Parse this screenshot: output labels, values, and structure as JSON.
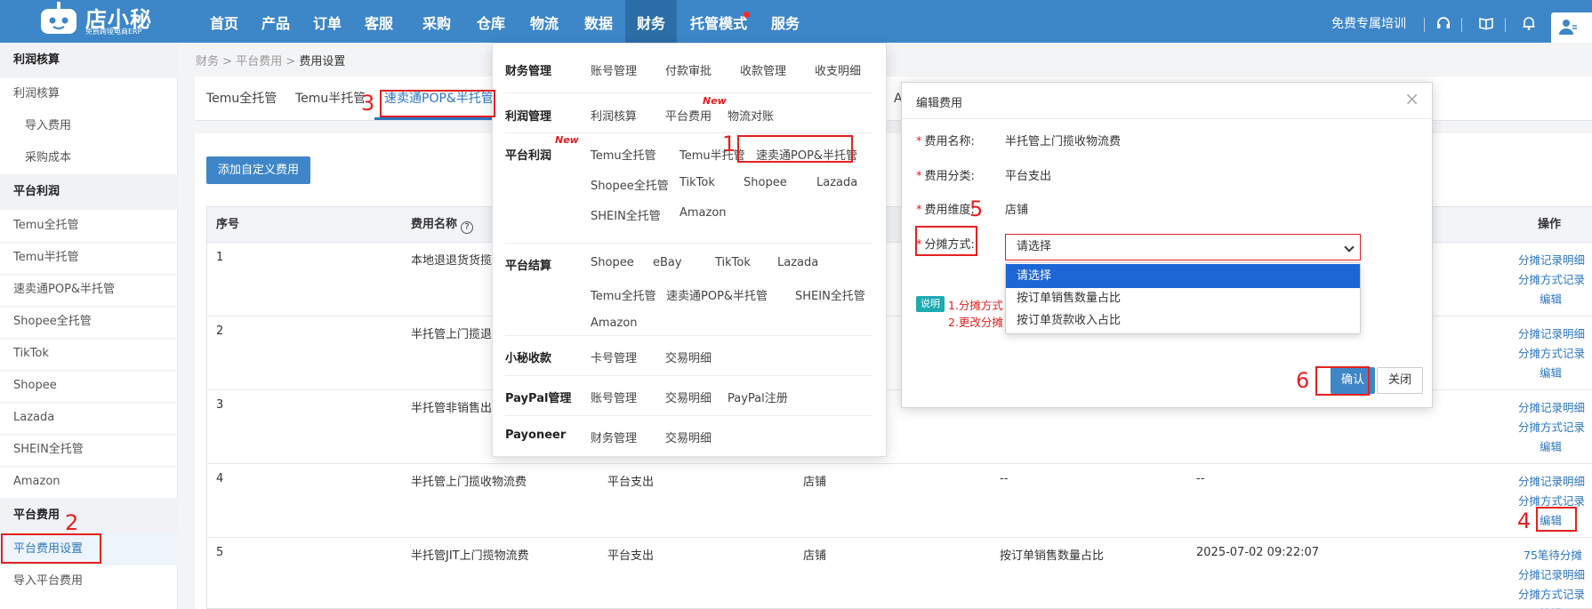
{
  "logo": {
    "title": "店小秘",
    "subtitle": "免费跨境电商ERP"
  },
  "nav": [
    "首页",
    "产品",
    "订单",
    "客服",
    "采购",
    "仓库",
    "物流",
    "数据",
    "财务",
    "托管模式",
    "服务"
  ],
  "topRight": {
    "training": "免费专属培训"
  },
  "sidebar": {
    "sections": [
      {
        "title": "利润核算",
        "items": [
          "利润核算",
          "导入费用",
          "采购成本"
        ]
      },
      {
        "title": "平台利润",
        "items": [
          "Temu全托管",
          "Temu半托管",
          "速卖通POP&半托管",
          "Shopee全托管",
          "TikTok",
          "Shopee",
          "Lazada",
          "SHEIN全托管",
          "Amazon"
        ]
      },
      {
        "title": "平台费用",
        "items": [
          "平台费用设置",
          "导入平台费用"
        ]
      }
    ]
  },
  "breadcrumb": {
    "a": "财务",
    "b": "平台费用",
    "c": "费用设置",
    "sep": " > "
  },
  "tabs": [
    "Temu全托管",
    "Temu半托管",
    "速卖通POP&半托管",
    "A"
  ],
  "addButton": "添加自定义费用",
  "table": {
    "headers": {
      "no": "序号",
      "name": "费用名称",
      "help": "?",
      "ops": "操作"
    },
    "rows": [
      {
        "no": "1",
        "name": "本地退退货货揽",
        "cat": "",
        "dim": "",
        "method": "",
        "time": "",
        "ops": [
          "分摊记录明细",
          "分摊方式记录",
          "编辑"
        ]
      },
      {
        "no": "2",
        "name": "半托管上门揽退",
        "cat": "",
        "dim": "",
        "method": "",
        "time": "",
        "ops": [
          "分摊记录明细",
          "分摊方式记录",
          "编辑"
        ]
      },
      {
        "no": "3",
        "name": "半托管非销售出",
        "cat": "",
        "dim": "",
        "method": "--",
        "time": "--",
        "ops": [
          "分摊记录明细",
          "分摊方式记录",
          "编辑"
        ]
      },
      {
        "no": "4",
        "name": "半托管上门揽收物流费",
        "cat": "平台支出",
        "dim": "店铺",
        "method": "--",
        "time": "--",
        "ops": [
          "分摊记录明细",
          "分摊方式记录",
          "编辑"
        ]
      },
      {
        "no": "5",
        "name": "半托管JIT上门揽物流费",
        "cat": "平台支出",
        "dim": "店铺",
        "method": "按订单销售数量占比",
        "time": "2025-07-02 09:22:07",
        "ops": [
          "75笔待分摊",
          "分摊记录明细",
          "分摊方式记录",
          "编辑"
        ]
      }
    ]
  },
  "mega": {
    "rows": [
      {
        "cat": "财务管理",
        "links": [
          "账号管理",
          "付款审批",
          "收款管理",
          "收支明细"
        ]
      },
      {
        "cat": "利润管理",
        "links": [
          "利润核算",
          "平台费用",
          "物流对账"
        ],
        "newTag": "New"
      },
      {
        "cat": "平台利润",
        "catNew": "New",
        "links": [
          "Temu全托管",
          "Temu半托管",
          "速卖通POP&半托管",
          "Shopee全托管",
          "TikTok",
          "Shopee",
          "Lazada",
          "SHEIN全托管",
          "Amazon"
        ]
      },
      {
        "cat": "平台结算",
        "links": [
          "Shopee",
          "eBay",
          "TikTok",
          "Lazada",
          "Temu全托管",
          "速卖通POP&半托管",
          "SHEIN全托管",
          "Amazon"
        ]
      },
      {
        "cat": "小秘收款",
        "links": [
          "卡号管理",
          "交易明细"
        ]
      },
      {
        "cat": "PayPal管理",
        "links": [
          "账号管理",
          "交易明细",
          "PayPal注册"
        ]
      },
      {
        "cat": "Payoneer",
        "links": [
          "财务管理",
          "交易明细"
        ]
      }
    ]
  },
  "modal": {
    "title": "编辑费用",
    "close": "×",
    "fields": [
      {
        "label": "费用名称:",
        "value": "半托管上门揽收物流费"
      },
      {
        "label": "费用分类:",
        "value": "平台支出"
      },
      {
        "label": "费用维度:",
        "value": "店铺"
      }
    ],
    "methodLabel": "分摊方式:",
    "select": {
      "value": "请选择",
      "options": [
        "请选择",
        "按订单销售数量占比",
        "按订单货款收入占比"
      ]
    },
    "note": {
      "badge": "说明",
      "line1": "1.分摊方式",
      "line2": "2.更改分摊"
    },
    "confirm": "确认",
    "cancel": "关闭"
  },
  "annotations": [
    "1",
    "2",
    "3",
    "4",
    "5",
    "6"
  ],
  "colors": {
    "nav": "#3d86c8",
    "accent": "#2d76c0",
    "annotation": "#e52020"
  }
}
